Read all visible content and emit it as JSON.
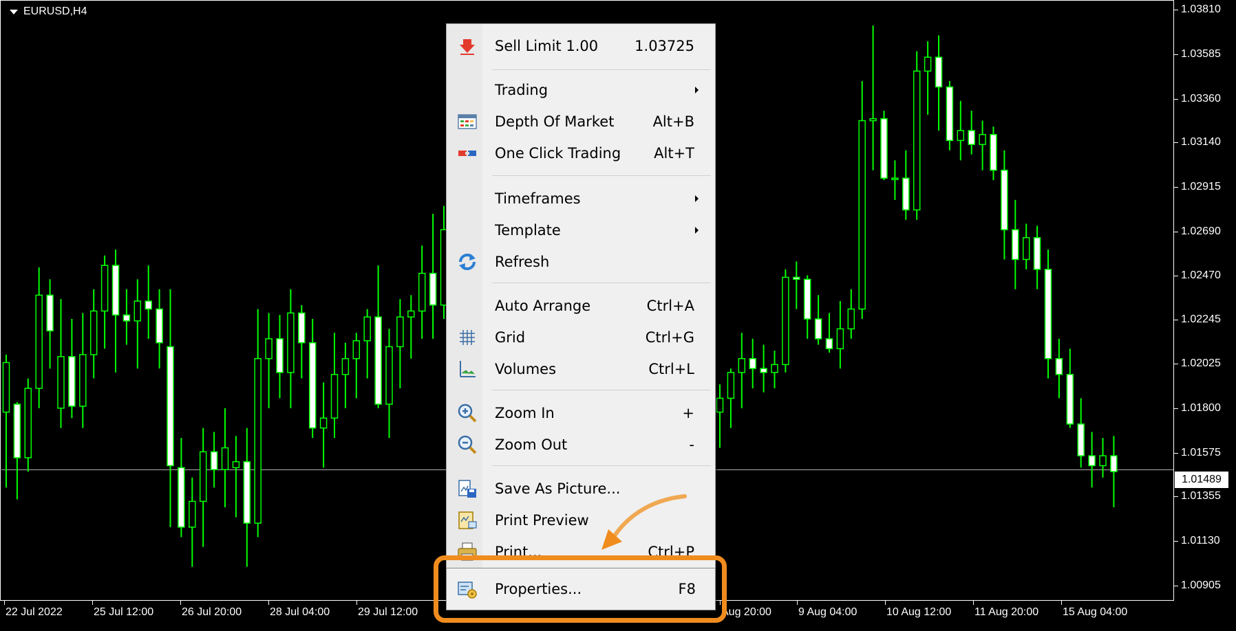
{
  "chart": {
    "symbol": "EURUSD,H4",
    "colors": {
      "background": "#000000",
      "candle": "#00ff00",
      "bid_line": "#b0b0b0",
      "axis_text": "#ffffff"
    },
    "current_price": "1.01489",
    "price_axis": [
      "1.03810",
      "1.03585",
      "1.03360",
      "1.03140",
      "1.02915",
      "1.02690",
      "1.02470",
      "1.02245",
      "1.02025",
      "1.01800",
      "1.01575",
      "1.01355",
      "1.01130",
      "1.00905"
    ],
    "time_axis": [
      "22 Jul 2022",
      "25 Jul 12:00",
      "26 Jul 20:00",
      "28 Jul 04:00",
      "29 Jul 12:00",
      "Aug 20:00",
      "9 Aug 04:00",
      "10 Aug 12:00",
      "11 Aug 20:00",
      "15 Aug 04:00"
    ]
  },
  "context_menu": {
    "items": [
      {
        "label": "Sell Limit 1.00",
        "shortcut": "1.03725",
        "icon": "sell-limit-icon"
      },
      {
        "label": "Trading",
        "submenu": true
      },
      {
        "label": "Depth Of Market",
        "shortcut": "Alt+B",
        "icon": "depth-of-market-icon"
      },
      {
        "label": "One Click Trading",
        "shortcut": "Alt+T",
        "icon": "one-click-trading-icon"
      },
      {
        "label": "Timeframes",
        "submenu": true
      },
      {
        "label": "Template",
        "submenu": true
      },
      {
        "label": "Refresh",
        "icon": "refresh-icon"
      },
      {
        "label": "Auto Arrange",
        "shortcut": "Ctrl+A"
      },
      {
        "label": "Grid",
        "shortcut": "Ctrl+G",
        "icon": "grid-icon"
      },
      {
        "label": "Volumes",
        "shortcut": "Ctrl+L",
        "icon": "volumes-icon"
      },
      {
        "label": "Zoom In",
        "shortcut": "+",
        "icon": "zoom-in-icon"
      },
      {
        "label": "Zoom Out",
        "shortcut": "-",
        "icon": "zoom-out-icon"
      },
      {
        "label": "Save As Picture...",
        "icon": "save-picture-icon"
      },
      {
        "label": "Print Preview",
        "icon": "print-preview-icon"
      },
      {
        "label": "Print...",
        "shortcut": "Ctrl+P",
        "icon": "print-icon"
      },
      {
        "label": "Properties...",
        "shortcut": "F8",
        "icon": "properties-icon"
      }
    ],
    "highlight_color": "#f08c1e"
  },
  "chart_data": {
    "type": "candlestick",
    "title": "EURUSD,H4",
    "ylim": [
      1.00905,
      1.0381
    ],
    "y_ticks": [
      1.0381,
      1.03585,
      1.0336,
      1.0314,
      1.02915,
      1.0269,
      1.0247,
      1.02245,
      1.02025,
      1.018,
      1.01575,
      1.01355,
      1.0113,
      1.00905
    ],
    "x_tick_labels": [
      "22 Jul 2022",
      "25 Jul 12:00",
      "26 Jul 20:00",
      "28 Jul 04:00",
      "29 Jul 12:00",
      "Aug 20:00",
      "9 Aug 04:00",
      "10 Aug 12:00",
      "11 Aug 20:00",
      "15 Aug 04:00"
    ],
    "bid": 1.01489,
    "candles_ohlc": [
      [
        1.0178,
        1.0207,
        1.014,
        1.0203
      ],
      [
        1.0182,
        1.0183,
        1.0134,
        1.0155
      ],
      [
        1.0155,
        1.0195,
        1.0148,
        1.019
      ],
      [
        1.019,
        1.0251,
        1.018,
        1.0237
      ],
      [
        1.0237,
        1.0245,
        1.02,
        1.0219
      ],
      [
        1.018,
        1.0235,
        1.017,
        1.0206
      ],
      [
        1.0206,
        1.0225,
        1.0175,
        1.0181
      ],
      [
        1.0181,
        1.0228,
        1.017,
        1.0207
      ],
      [
        1.0207,
        1.024,
        1.0195,
        1.0229
      ],
      [
        1.0229,
        1.0257,
        1.021,
        1.0252
      ],
      [
        1.0252,
        1.026,
        1.0198,
        1.0227
      ],
      [
        1.0227,
        1.024,
        1.0212,
        1.0224
      ],
      [
        1.0224,
        1.0245,
        1.02,
        1.0234
      ],
      [
        1.0234,
        1.0252,
        1.0215,
        1.023
      ],
      [
        1.023,
        1.024,
        1.02,
        1.0213
      ],
      [
        1.0211,
        1.024,
        1.012,
        1.0151
      ],
      [
        1.015,
        1.0165,
        1.0115,
        1.012
      ],
      [
        1.012,
        1.0145,
        1.01,
        1.0133
      ],
      [
        1.0133,
        1.017,
        1.011,
        1.0158
      ],
      [
        1.0158,
        1.0168,
        1.014,
        1.0149
      ],
      [
        1.0149,
        1.018,
        1.013,
        1.016
      ],
      [
        1.015,
        1.0166,
        1.0125,
        1.0153
      ],
      [
        1.0153,
        1.017,
        1.01,
        1.0122
      ],
      [
        1.0122,
        1.023,
        1.0115,
        1.0205
      ],
      [
        1.0205,
        1.0228,
        1.018,
        1.0215
      ],
      [
        1.0215,
        1.0227,
        1.0185,
        1.0198
      ],
      [
        1.0198,
        1.024,
        1.018,
        1.0228
      ],
      [
        1.0228,
        1.0232,
        1.0195,
        1.0213
      ],
      [
        1.0213,
        1.0225,
        1.0165,
        1.017
      ],
      [
        1.017,
        1.0193,
        1.015,
        1.0175
      ],
      [
        1.0175,
        1.0218,
        1.0165,
        1.0197
      ],
      [
        1.0197,
        1.0213,
        1.018,
        1.0205
      ],
      [
        1.0205,
        1.0218,
        1.0185,
        1.0214
      ],
      [
        1.0214,
        1.023,
        1.0195,
        1.0226
      ],
      [
        1.0226,
        1.0252,
        1.018,
        1.0182
      ],
      [
        1.0182,
        1.022,
        1.0165,
        1.0211
      ],
      [
        1.0211,
        1.0235,
        1.019,
        1.0226
      ],
      [
        1.0226,
        1.0237,
        1.0205,
        1.0229
      ],
      [
        1.0229,
        1.0262,
        1.0215,
        1.0248
      ],
      [
        1.0248,
        1.0278,
        1.0215,
        1.0232
      ],
      [
        1.0232,
        1.0282,
        1.0225,
        1.027
      ]
    ],
    "candles_ohlc_right": [
      [
        1.0178,
        1.0192,
        1.016,
        1.0185
      ],
      [
        1.0185,
        1.02,
        1.017,
        1.0198
      ],
      [
        1.0198,
        1.0218,
        1.018,
        1.0205
      ],
      [
        1.0205,
        1.0215,
        1.019,
        1.02
      ],
      [
        1.02,
        1.0212,
        1.0188,
        1.0198
      ],
      [
        1.0198,
        1.0209,
        1.019,
        1.0202
      ],
      [
        1.0202,
        1.025,
        1.0198,
        1.0246
      ],
      [
        1.0246,
        1.0254,
        1.023,
        1.0245
      ],
      [
        1.0245,
        1.0247,
        1.0215,
        1.0225
      ],
      [
        1.0225,
        1.0237,
        1.0212,
        1.0215
      ],
      [
        1.0215,
        1.0228,
        1.0208,
        1.021
      ],
      [
        1.021,
        1.0234,
        1.02,
        1.022
      ],
      [
        1.022,
        1.024,
        1.0215,
        1.023
      ],
      [
        1.023,
        1.0345,
        1.0225,
        1.0325
      ],
      [
        1.0325,
        1.0373,
        1.03,
        1.0326
      ],
      [
        1.0326,
        1.033,
        1.0295,
        1.0296
      ],
      [
        1.0296,
        1.0305,
        1.0285,
        1.0296
      ],
      [
        1.0296,
        1.031,
        1.0275,
        1.028
      ],
      [
        1.028,
        1.036,
        1.0275,
        1.035
      ],
      [
        1.035,
        1.0365,
        1.0328,
        1.0357
      ],
      [
        1.0357,
        1.0368,
        1.032,
        1.0342
      ],
      [
        1.0342,
        1.0345,
        1.031,
        1.0315
      ],
      [
        1.0315,
        1.0335,
        1.0305,
        1.032
      ],
      [
        1.032,
        1.033,
        1.0308,
        1.0313
      ],
      [
        1.0313,
        1.0325,
        1.03,
        1.0318
      ],
      [
        1.0318,
        1.0322,
        1.0295,
        1.03
      ],
      [
        1.03,
        1.031,
        1.0255,
        1.027
      ],
      [
        1.027,
        1.0285,
        1.024,
        1.0255
      ],
      [
        1.0255,
        1.0273,
        1.025,
        1.0266
      ],
      [
        1.0266,
        1.0272,
        1.024,
        1.025
      ],
      [
        1.025,
        1.026,
        1.0195,
        1.0205
      ],
      [
        1.0205,
        1.0215,
        1.0185,
        1.0197
      ],
      [
        1.0197,
        1.021,
        1.017,
        1.0172
      ],
      [
        1.0172,
        1.0185,
        1.015,
        1.0156
      ],
      [
        1.0156,
        1.0168,
        1.014,
        1.0151
      ],
      [
        1.0151,
        1.0165,
        1.0145,
        1.0156
      ],
      [
        1.0156,
        1.0166,
        1.013,
        1.0148
      ]
    ]
  }
}
